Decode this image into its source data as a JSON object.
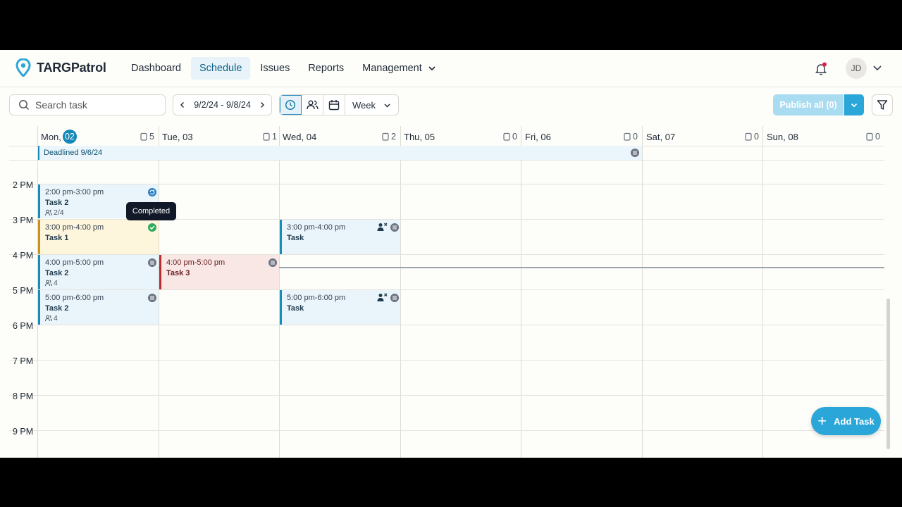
{
  "app": {
    "name": "TARGPatrol"
  },
  "nav": {
    "items": [
      "Dashboard",
      "Schedule",
      "Issues",
      "Reports",
      "Management"
    ],
    "active": "Schedule"
  },
  "user": {
    "initials": "JD"
  },
  "toolbar": {
    "search_placeholder": "Search task",
    "date_range": "9/2/24 - 9/8/24",
    "view": "Week",
    "publish_label": "Publish all (0)",
    "add_task_label": "Add Task"
  },
  "days": [
    {
      "name": "Mon,",
      "num": "02",
      "count": "5"
    },
    {
      "name": "Tue, 03",
      "count": "1"
    },
    {
      "name": "Wed, 04",
      "count": "2"
    },
    {
      "name": "Thu, 05",
      "count": "0"
    },
    {
      "name": "Fri, 06",
      "count": "0"
    },
    {
      "name": "Sat, 07",
      "count": "0"
    },
    {
      "name": "Sun, 08",
      "count": "0"
    }
  ],
  "deadline": {
    "label": "Deadlined 9/6/24"
  },
  "hours": [
    "2 PM",
    "3 PM",
    "4 PM",
    "5 PM",
    "6 PM",
    "7 PM",
    "8 PM",
    "9 PM"
  ],
  "events": [
    {
      "time": "2:00 pm-3:00 pm",
      "name": "Task 2",
      "count": "2/4"
    },
    {
      "time": "3:00 pm-4:00 pm",
      "name": "Task 1"
    },
    {
      "time": "4:00 pm-5:00 pm",
      "name": "Task 2",
      "count": "4"
    },
    {
      "time": "5:00 pm-6:00 pm",
      "name": "Task 2",
      "count": "4"
    },
    {
      "time": "4:00 pm-5:00 pm",
      "name": "Task 3"
    },
    {
      "time": "3:00 pm-4:00 pm",
      "name": "Task"
    },
    {
      "time": "5:00 pm-6:00 pm",
      "name": "Task"
    }
  ],
  "tooltip": {
    "text": "Completed"
  },
  "colors": {
    "accent": "#2ba6d8",
    "event_blue": "#1a8cba",
    "event_yellow": "#c99320",
    "event_red": "#b92c2c"
  }
}
